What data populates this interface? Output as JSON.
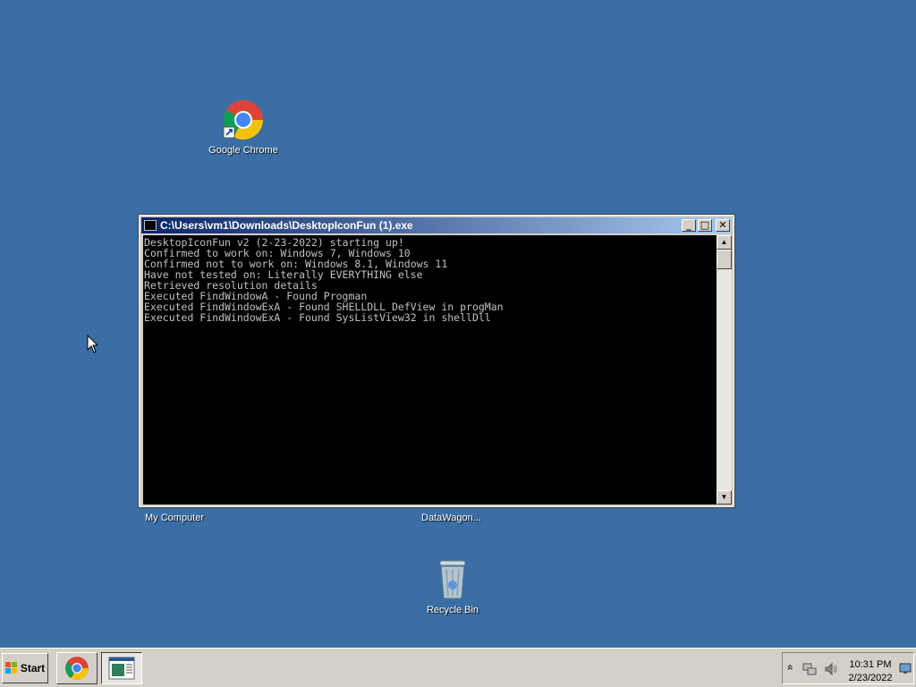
{
  "desktop": {
    "icons": {
      "chrome": "Google Chrome",
      "my_computer": "My Computer",
      "datawagon": "DataWagon...",
      "recycle_bin": "Recycle Bin"
    },
    "background_color": "#3a6ea5"
  },
  "console": {
    "title": "C:\\Users\\vm1\\Downloads\\DesktopIconFun (1).exe",
    "buttons": {
      "minimize": "_",
      "maximize": "□",
      "close": "✕"
    },
    "lines": [
      "DesktopIconFun v2 (2-23-2022) starting up!",
      "Confirmed to work on: Windows 7, Windows 10",
      "Confirmed not to work on: Windows 8.1, Windows 11",
      "Have not tested on: Literally EVERYTHING else",
      "Retrieved resolution details",
      "Executed FindWindowA - Found Progman",
      "Executed FindWindowExA - Found SHELLDLL_DefView in progMan",
      "Executed FindWindowExA - Found SysListView32 in shellDll"
    ],
    "scroll_up": "▲",
    "scroll_down": "▼"
  },
  "taskbar": {
    "start_label": "Start",
    "apps": [
      "chrome-icon",
      "console-icon"
    ],
    "tray": {
      "expand": "»",
      "time": "10:31 PM",
      "date": "2/23/2022"
    }
  }
}
